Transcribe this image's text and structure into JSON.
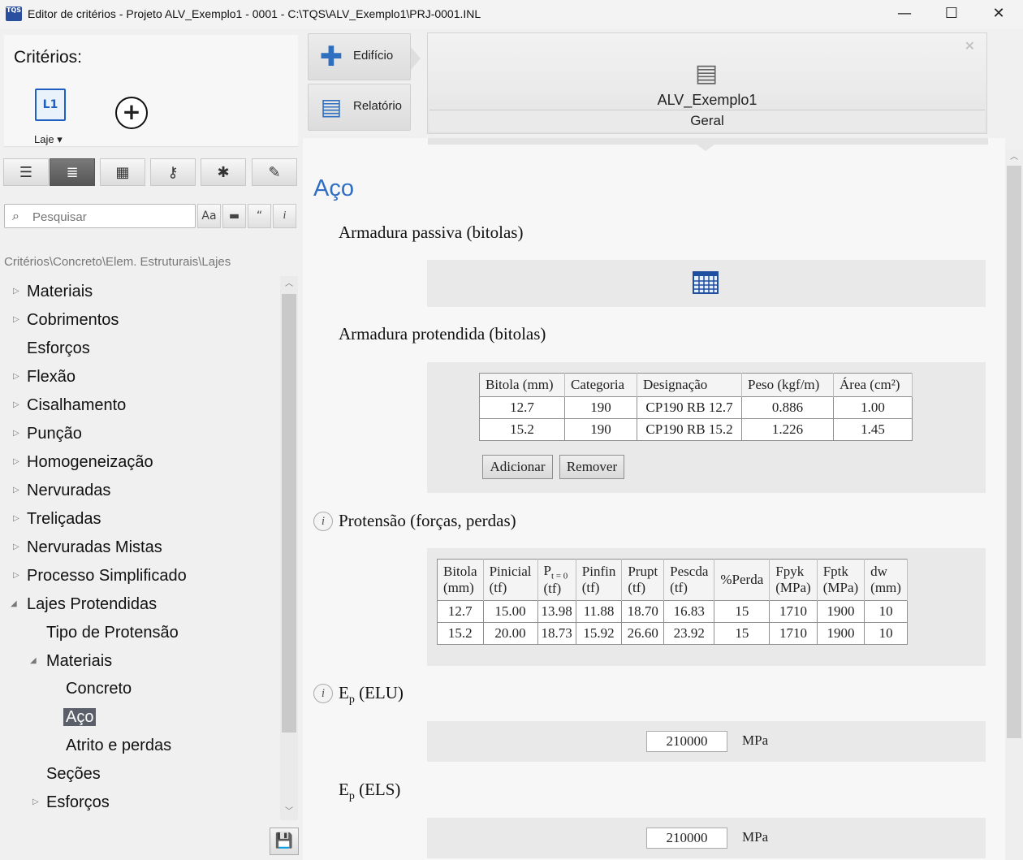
{
  "window": {
    "app_icon_text": "TQS",
    "title": "Editor de critérios - Projeto ALV_Exemplo1 - 0001 - C:\\TQS\\ALV_Exemplo1\\PRJ-0001.INL",
    "minimize": "—",
    "maximize": "☐",
    "close": "✕"
  },
  "criteria_panel": {
    "title": "Critérios:",
    "laje_icon_text": "L1",
    "laje_label": "Laje ▾",
    "add_symbol": "+"
  },
  "toolbar": {
    "icons": [
      "list-icon",
      "list-centered-icon",
      "grid-icon",
      "key-icon",
      "asterisk-icon",
      "pencil-icon"
    ],
    "active_index": 1
  },
  "search": {
    "placeholder": "Pesquisar",
    "btn_case": "Aa",
    "btn_bar": "▬",
    "btn_quote": "“",
    "btn_info": "i"
  },
  "breadcrumb": "Critérios\\Concreto\\Elem. Estruturais\\Lajes",
  "tree": [
    {
      "label": "Materiais",
      "arrow": "▷"
    },
    {
      "label": "Cobrimentos",
      "arrow": "▷"
    },
    {
      "label": "Esforços",
      "arrow": ""
    },
    {
      "label": "Flexão",
      "arrow": "▷"
    },
    {
      "label": "Cisalhamento",
      "arrow": "▷"
    },
    {
      "label": "Punção",
      "arrow": "▷"
    },
    {
      "label": "Homogeneização",
      "arrow": "▷"
    },
    {
      "label": "Nervuradas",
      "arrow": "▷"
    },
    {
      "label": "Treliçadas",
      "arrow": "▷"
    },
    {
      "label": "Nervuradas Mistas",
      "arrow": "▷"
    },
    {
      "label": "Processo Simplificado",
      "arrow": "▷"
    },
    {
      "label": "Lajes Protendidas",
      "arrow": "◢"
    },
    {
      "label": "Tipo de Protensão",
      "arrow": ""
    },
    {
      "label": "Materiais",
      "arrow": "◢"
    },
    {
      "label": "Concreto",
      "arrow": ""
    },
    {
      "label": "Aço",
      "arrow": "",
      "selected": true
    },
    {
      "label": "Atrito e perdas",
      "arrow": ""
    },
    {
      "label": "Seções",
      "arrow": ""
    },
    {
      "label": "Esforços",
      "arrow": "▷"
    }
  ],
  "tabs": {
    "edificio": "Edifício",
    "relatorio": "Relatório"
  },
  "building": {
    "name": "ALV_Exemplo1",
    "tab": "Geral"
  },
  "content": {
    "section_title": "Aço",
    "passiva_title": "Armadura passiva (bitolas)",
    "protendida_title": "Armadura protendida (bitolas)",
    "protendida_table": {
      "headers": [
        "Bitola (mm)",
        "Categoria",
        "Designação",
        "Peso (kgf/m)",
        "Área (cm²)"
      ],
      "rows": [
        [
          "12.7",
          "190",
          "CP190 RB 12.7",
          "0.886",
          "1.00"
        ],
        [
          "15.2",
          "190",
          "CP190 RB 15.2",
          "1.226",
          "1.45"
        ]
      ]
    },
    "btn_adicionar": "Adicionar",
    "btn_remover": "Remover",
    "protensao_title": "Protensão (forças, perdas)",
    "protensao_table": {
      "headers_line1": [
        "Bitola",
        "Pinicial",
        "P",
        "Pinfin",
        "Prupt",
        "Pescda",
        "%Perda",
        "Fpyk",
        "Fptk",
        "dw"
      ],
      "p_subscript": "t = 0",
      "headers_line2": [
        "(mm)",
        "(tf)",
        "(tf)",
        "(tf)",
        "(tf)",
        "(tf)",
        "",
        "(MPa)",
        "(MPa)",
        "(mm)"
      ],
      "rows": [
        [
          "12.7",
          "15.00",
          "13.98",
          "11.88",
          "18.70",
          "16.83",
          "15",
          "1710",
          "1900",
          "10"
        ],
        [
          "15.2",
          "20.00",
          "18.73",
          "15.92",
          "26.60",
          "23.92",
          "15",
          "1710",
          "1900",
          "10"
        ]
      ]
    },
    "ep_elu_E": "E",
    "ep_elu_sub": "p",
    "ep_elu_suffix": " (ELU)",
    "ep_elu_value": "210000",
    "ep_elu_unit": "MPa",
    "ep_els_E": "E",
    "ep_els_sub": "p",
    "ep_els_suffix": " (ELS)",
    "ep_els_value": "210000",
    "ep_els_unit": "MPa"
  }
}
